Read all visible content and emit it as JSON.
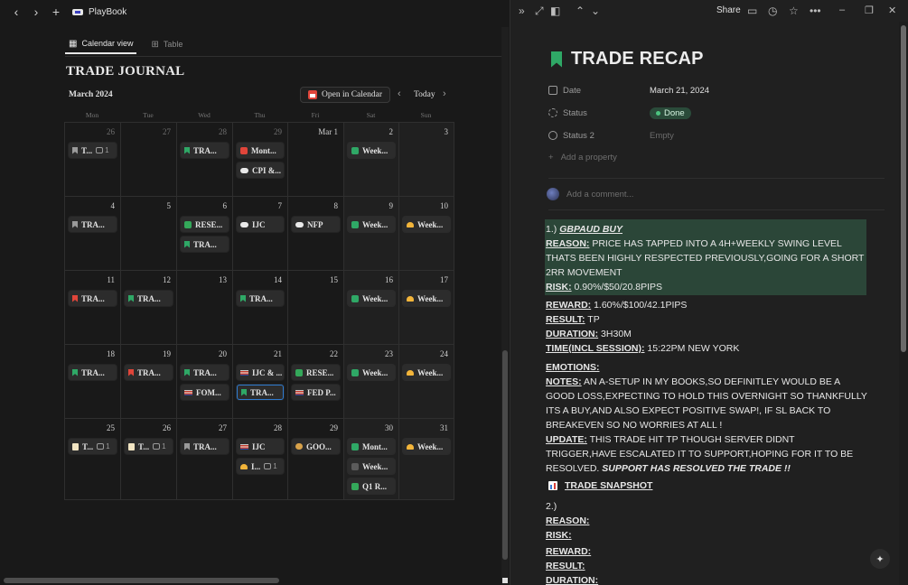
{
  "left": {
    "app_title": "PlayBook",
    "views": [
      "Calendar view",
      "Table"
    ],
    "journal_title": "TRADE JOURNAL",
    "month": "March 2024",
    "open_calendar": "Open in Calendar",
    "today": "Today",
    "weekdays": [
      "Mon",
      "Tue",
      "Wed",
      "Thu",
      "Fri",
      "Sat",
      "Sun"
    ],
    "weeks": [
      [
        {
          "day": "26",
          "dim": true,
          "events": [
            {
              "label": "T...",
              "icon": "grey",
              "comments": "1"
            }
          ]
        },
        {
          "day": "27",
          "dim": true,
          "events": []
        },
        {
          "day": "28",
          "dim": true,
          "events": [
            {
              "label": "TRA...",
              "icon": "green"
            }
          ]
        },
        {
          "day": "29",
          "dim": true,
          "events": [
            {
              "label": "Mont...",
              "icon": "bk"
            },
            {
              "label": "CPI &...",
              "icon": "cloud"
            }
          ]
        },
        {
          "day": "Mar 1",
          "dim": false,
          "events": []
        },
        {
          "day": "2",
          "dim": false,
          "events": [
            {
              "label": "Week...",
              "icon": "sq-green"
            }
          ]
        },
        {
          "day": "3",
          "dim": false,
          "events": []
        }
      ],
      [
        {
          "day": "4",
          "dim": false,
          "events": [
            {
              "label": "TRA...",
              "icon": "grey"
            }
          ]
        },
        {
          "day": "5",
          "dim": false,
          "events": []
        },
        {
          "day": "6",
          "dim": false,
          "events": [
            {
              "label": "RESE...",
              "icon": "check"
            },
            {
              "label": "TRA...",
              "icon": "green"
            }
          ]
        },
        {
          "day": "7",
          "dim": false,
          "events": [
            {
              "label": "IJC",
              "icon": "cloud"
            }
          ]
        },
        {
          "day": "8",
          "dim": false,
          "events": [
            {
              "label": "NFP",
              "icon": "cloud"
            }
          ]
        },
        {
          "day": "9",
          "dim": false,
          "events": [
            {
              "label": "Week...",
              "icon": "sq-green"
            }
          ]
        },
        {
          "day": "10",
          "dim": false,
          "events": [
            {
              "label": "Week...",
              "icon": "sun"
            }
          ]
        }
      ],
      [
        {
          "day": "11",
          "dim": false,
          "events": [
            {
              "label": "TRA...",
              "icon": "red"
            }
          ]
        },
        {
          "day": "12",
          "dim": false,
          "events": [
            {
              "label": "TRA...",
              "icon": "green"
            }
          ]
        },
        {
          "day": "13",
          "dim": false,
          "events": []
        },
        {
          "day": "14",
          "dim": false,
          "events": [
            {
              "label": "TRA...",
              "icon": "green"
            }
          ]
        },
        {
          "day": "15",
          "dim": false,
          "events": []
        },
        {
          "day": "16",
          "dim": false,
          "events": [
            {
              "label": "Week...",
              "icon": "sq-green"
            }
          ]
        },
        {
          "day": "17",
          "dim": false,
          "events": [
            {
              "label": "Week...",
              "icon": "sun"
            }
          ]
        }
      ],
      [
        {
          "day": "18",
          "dim": false,
          "events": [
            {
              "label": "TRA...",
              "icon": "green"
            }
          ]
        },
        {
          "day": "19",
          "dim": false,
          "events": [
            {
              "label": "TRA...",
              "icon": "red"
            }
          ]
        },
        {
          "day": "20",
          "dim": false,
          "events": [
            {
              "label": "TRA...",
              "icon": "green"
            },
            {
              "label": "FOM...",
              "icon": "flag"
            }
          ]
        },
        {
          "day": "21",
          "dim": false,
          "events": [
            {
              "label": "IJC & ...",
              "icon": "flag"
            },
            {
              "label": "TRA...",
              "icon": "green",
              "selected": true
            }
          ]
        },
        {
          "day": "22",
          "dim": false,
          "events": [
            {
              "label": "RESE...",
              "icon": "check"
            },
            {
              "label": "FED P...",
              "icon": "flag"
            }
          ]
        },
        {
          "day": "23",
          "dim": false,
          "events": [
            {
              "label": "Week...",
              "icon": "sq-green"
            }
          ]
        },
        {
          "day": "24",
          "dim": false,
          "events": [
            {
              "label": "Week...",
              "icon": "sun"
            }
          ]
        }
      ],
      [
        {
          "day": "25",
          "dim": false,
          "events": [
            {
              "label": "T...",
              "icon": "memo",
              "comments": "1"
            }
          ]
        },
        {
          "day": "26",
          "dim": false,
          "events": [
            {
              "label": "T...",
              "icon": "memo",
              "comments": "1"
            }
          ]
        },
        {
          "day": "27",
          "dim": false,
          "events": [
            {
              "label": "TRA...",
              "icon": "grey"
            }
          ]
        },
        {
          "day": "28",
          "dim": false,
          "events": [
            {
              "label": "IJC",
              "icon": "flag"
            },
            {
              "label": "I...",
              "icon": "sun",
              "comments": "1"
            }
          ]
        },
        {
          "day": "29",
          "dim": false,
          "events": [
            {
              "label": "GOO...",
              "icon": "money"
            }
          ]
        },
        {
          "day": "30",
          "dim": false,
          "events": [
            {
              "label": "Mont...",
              "icon": "sq-green"
            },
            {
              "label": "Week...",
              "icon": "cal"
            },
            {
              "label": "Q1 R...",
              "icon": "check"
            }
          ]
        },
        {
          "day": "31",
          "dim": false,
          "events": [
            {
              "label": "Week...",
              "icon": "sun"
            }
          ]
        }
      ]
    ]
  },
  "right": {
    "share": "Share",
    "title": "TRADE RECAP",
    "props": [
      {
        "key": "Date",
        "value": "March 21, 2024",
        "type": "text"
      },
      {
        "key": "Status",
        "value": "Done",
        "type": "pill"
      },
      {
        "key": "Status 2",
        "value": "Empty",
        "type": "empty"
      }
    ],
    "add_property": "Add a property",
    "add_comment": "Add a comment...",
    "trade1": {
      "num": "1.)",
      "pair": "GBPAUD BUY",
      "reason_k": "REASON:",
      "reason_v": " PRICE HAS TAPPED INTO A 4H+WEEKLY SWING LEVEL THATS BEEN HIGHLY RESPECTED PREVIOUSLY,GOING FOR A SHORT 2RR MOVEMENT",
      "risk_k": "RISK:",
      "risk_v": " 0.90%/$50/20.8PIPS",
      "reward_k": "REWARD:",
      "reward_v": " 1.60%/$100/42.1PIPS",
      "result_k": "RESULT:",
      "result_v": " TP",
      "duration_k": "DURATION:",
      "duration_v": " 3H30M",
      "time_k": "TIME(INCL SESSION):",
      "time_v": " 15:22PM NEW YORK",
      "emotions_k": "EMOTIONS:",
      "notes_k": "NOTES:",
      "notes_v": " AN A-SETUP IN MY BOOKS,SO DEFINITLEY WOULD BE A GOOD LOSS,EXPECTING TO HOLD THIS OVERNIGHT SO THANKFULLY ITS A BUY,AND ALSO EXPECT POSITIVE SWAP!, IF SL BACK TO BREAKEVEN SO NO WORRIES AT ALL !",
      "update_k": "UPDATE:",
      "update_v": " THIS TRADE HIT TP THOUGH SERVER DIDNT TRIGGER,HAVE ESCALATED IT TO SUPPORT,HOPING FOR IT  TO BE RESOLVED. ",
      "update_bold": "SUPPORT HAS RESOLVED THE TRADE !!"
    },
    "snapshot": "TRADE SNAPSHOT",
    "trade2": {
      "num": "2.)",
      "reason_k": "REASON:",
      "risk_k": "RISK:",
      "reward_k": "REWARD:",
      "result_k": "RESULT:",
      "duration_k": "DURATION:"
    }
  }
}
